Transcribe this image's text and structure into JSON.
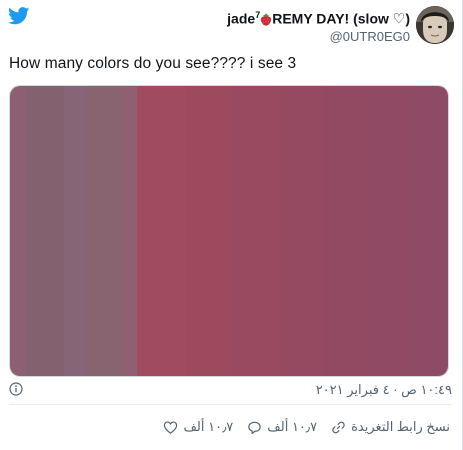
{
  "colors": {
    "twitter_blue": "#1d9bf0",
    "text_primary": "#0f1419",
    "text_secondary": "#536471",
    "heart_red": "#e0245e"
  },
  "header": {
    "logo_icon": "twitter-bird-icon",
    "display_name_prefix": "jade",
    "display_name_superscript": "7",
    "display_name_emoji_icon": "strawberry-icon",
    "display_name_rest": "REMY DAY! (slow ♡)",
    "handle": "@0UTR0EG0"
  },
  "tweet": {
    "text": "How many colors do you see???? i see 3"
  },
  "media": {
    "stripes": [
      {
        "color": "#8c5f72",
        "weight": 2.3
      },
      {
        "color": "#84616f",
        "weight": 5.2
      },
      {
        "color": "#876579",
        "weight": 3.0
      },
      {
        "color": "#876470",
        "weight": 5.0
      },
      {
        "color": "#8f6071",
        "weight": 2.0
      },
      {
        "color": "#a04b5f",
        "weight": 7.0
      },
      {
        "color": "#9d4a5e",
        "weight": 6.0
      },
      {
        "color": "#9a4a60",
        "weight": 7.0
      },
      {
        "color": "#964a61",
        "weight": 6.0
      },
      {
        "color": "#924a63",
        "weight": 6.0
      },
      {
        "color": "#904a64",
        "weight": 6.0
      },
      {
        "color": "#8e4b65",
        "weight": 5.0
      }
    ]
  },
  "meta": {
    "info_icon": "info-icon",
    "timestamp": "١٠:٤٩ ص · ٤ فبراير ٢٠٢١"
  },
  "actions": {
    "like_count": "١٠٫٧ ألف",
    "like_icon": "heart-icon",
    "reply_count": "١٠٫٧ ألف",
    "reply_icon": "reply-bubble-icon",
    "copy_link_label": "نسخ رابط التغريدة",
    "copy_link_icon": "link-icon"
  }
}
